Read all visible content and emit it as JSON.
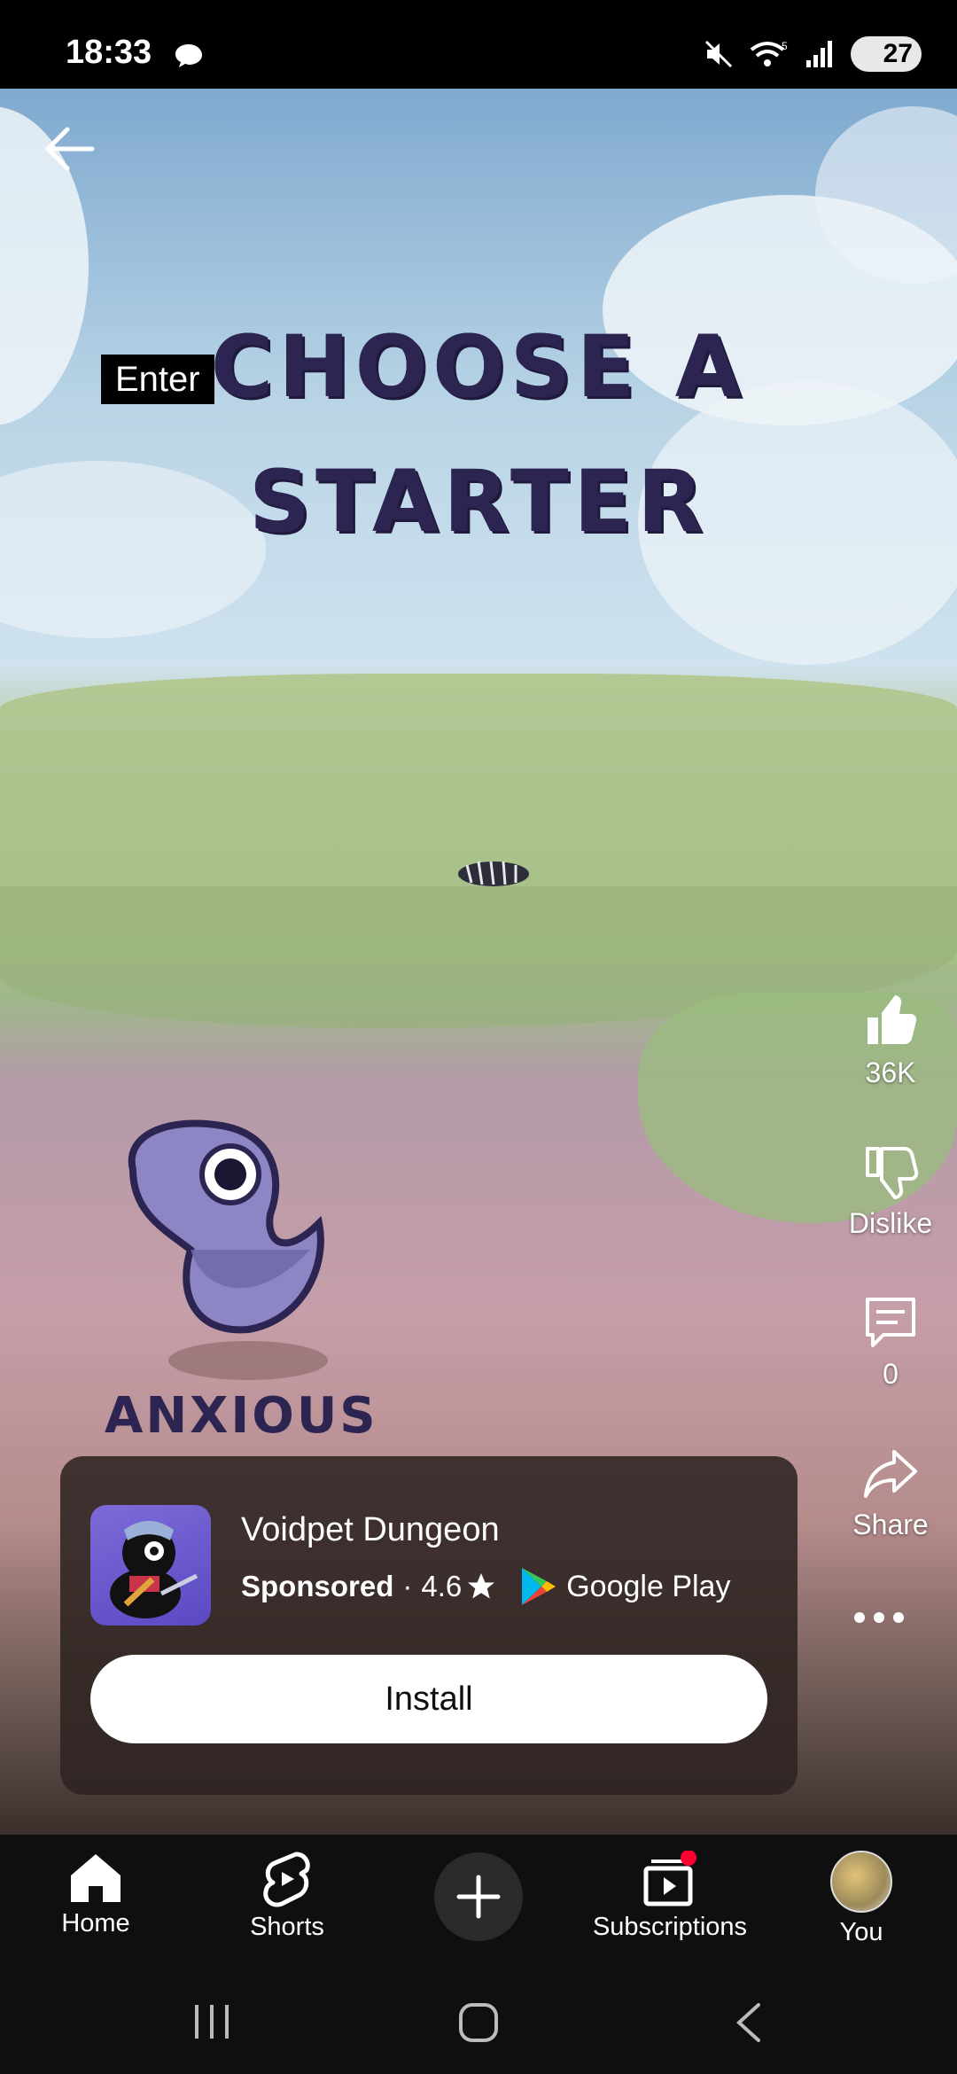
{
  "status_bar": {
    "time": "18:33",
    "battery": "27",
    "icons": [
      "chat-bubble-icon",
      "mute-icon",
      "wifi-icon",
      "signal-icon",
      "battery-icon"
    ]
  },
  "video": {
    "overlay_label": "Enter",
    "title_line1": "CHOOSE A",
    "title_line2": "STARTER",
    "creature_label": "ANXIOUS"
  },
  "actions": {
    "like_count": "36K",
    "dislike_label": "Dislike",
    "comment_count": "0",
    "share_label": "Share"
  },
  "ad": {
    "title": "Voidpet Dungeon",
    "sponsored": "Sponsored",
    "separator": "·",
    "rating": "4.6",
    "store": "Google Play",
    "install_label": "Install"
  },
  "nav": {
    "home": "Home",
    "shorts": "Shorts",
    "subscriptions": "Subscriptions",
    "you": "You"
  },
  "colors": {
    "title_text": "#2c2552",
    "nav_bg": "#0f0f0f",
    "notification_dot": "#ff0033"
  }
}
